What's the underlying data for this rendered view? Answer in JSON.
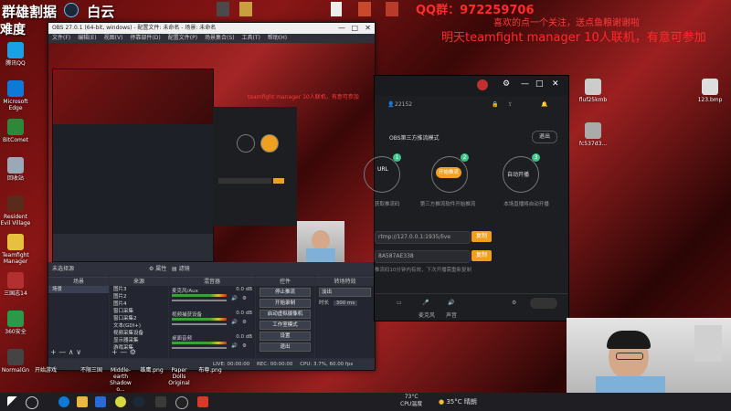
{
  "overlay": {
    "top_left_line1": "群雄割据",
    "top_left_line1b": "白云",
    "top_left_line2": "难度",
    "qq_group": "QQ群：972259706",
    "welcome": "喜欢的点一个关注，送点鱼粮谢谢啦",
    "announce": "明天teamfight manager 10人联机，有意可参加",
    "mini_announce": "teamfight manager 10人联机，有意可参加"
  },
  "desktop_icons": [
    {
      "label": "腾讯QQ",
      "color": "#1aa0e6"
    },
    {
      "label": "Microsoft Edge",
      "color": "#0e7ad8"
    },
    {
      "label": "BitComet",
      "color": "#2a8a3a"
    },
    {
      "label": "回收站",
      "color": "#9aa8b8"
    },
    {
      "label": "Resident Evil Village",
      "color": "#5a2a1a"
    },
    {
      "label": "Teamfight Manager",
      "color": "#e8c040"
    },
    {
      "label": "三国志14",
      "color": "#b33030"
    },
    {
      "label": "360安全",
      "color": "#2a9a4a"
    },
    {
      "label": "NormalGn",
      "color": "#444"
    }
  ],
  "desktop_icons_right": [
    {
      "label": "fluf25kmb",
      "color": "#ccc"
    },
    {
      "label": "fc537d3...",
      "color": "#aaa"
    },
    {
      "label": "123.bmp",
      "color": "#ddd"
    }
  ],
  "bottom_desktop_labels": [
    "开始游戏",
    "不限三国",
    "Middle-earth Shadow o...",
    "雄鹰.png",
    "Paper Dolls Original",
    "布尊.png"
  ],
  "obs": {
    "title": "OBS 27.0.1 (64-bit, windows) - 配置文件: 未命名 - 场景: 未命名",
    "menu": [
      "文件(F)",
      "编辑(E)",
      "视图(V)",
      "停靠部件(D)",
      "配置文件(P)",
      "场景集合(S)",
      "工具(T)",
      "帮助(H)"
    ],
    "scene_bar_label": "未选择源",
    "properties": "属性",
    "filters": "滤镜",
    "scenes_title": "场景",
    "scenes": [
      "场景"
    ],
    "sources_title": "来源",
    "sources": [
      "图片3",
      "图片2",
      "图片4",
      "窗口采集",
      "窗口采集2",
      "文本(GDI+)",
      "视频采集设备",
      "显示器采集",
      "游戏采集"
    ],
    "mixer_title": "混音器",
    "mixer_tracks": [
      {
        "name": "麦克风/Aux",
        "db": "0.0 dB"
      },
      {
        "name": "视频捕获设备",
        "db": "0.0 dB"
      },
      {
        "name": "桌面音频",
        "db": "0.0 dB"
      }
    ],
    "controls_title": "控件",
    "controls": [
      "停止推流",
      "开始录制",
      "启动虚拟摄像机",
      "工作室模式",
      "设置",
      "退出"
    ],
    "transitions_title": "转场特效",
    "transition": "淡出",
    "duration_label": "时长",
    "duration": "300 ms",
    "status": {
      "live": "LIVE: 00:00:00",
      "rec": "REC: 00:00:00",
      "cpu": "CPU: 3.7%, 60.00 fps"
    }
  },
  "app": {
    "user_number": "22152",
    "mode_label": "OBS第三方推流模式",
    "exit_button": "退出",
    "steps": [
      {
        "num": "1",
        "label": "URL",
        "sub": "获取推流码"
      },
      {
        "num": "2",
        "label": "开始推流",
        "sub": "第三方推流软件开始推流"
      },
      {
        "num": "3",
        "label": "自动开播",
        "sub": "本场直播将自动开播"
      }
    ],
    "url_value": "rtmp://127.0.0.1:1935/live",
    "key_value": "8A587AE338",
    "copy_label": "复制",
    "hint": "推流码10分钟内有效，下次开播需重新复制",
    "bottom_actions": [
      "麦克风",
      "声音"
    ]
  },
  "taskbar": {
    "weather": "35°C 晴朗",
    "cpu_temp": "73°C",
    "cpu_label": "CPU温度"
  },
  "colors": {
    "qq_red": "#ff2a2a",
    "accent_orange": "#f0a020",
    "accent_green": "#3fc48a"
  }
}
